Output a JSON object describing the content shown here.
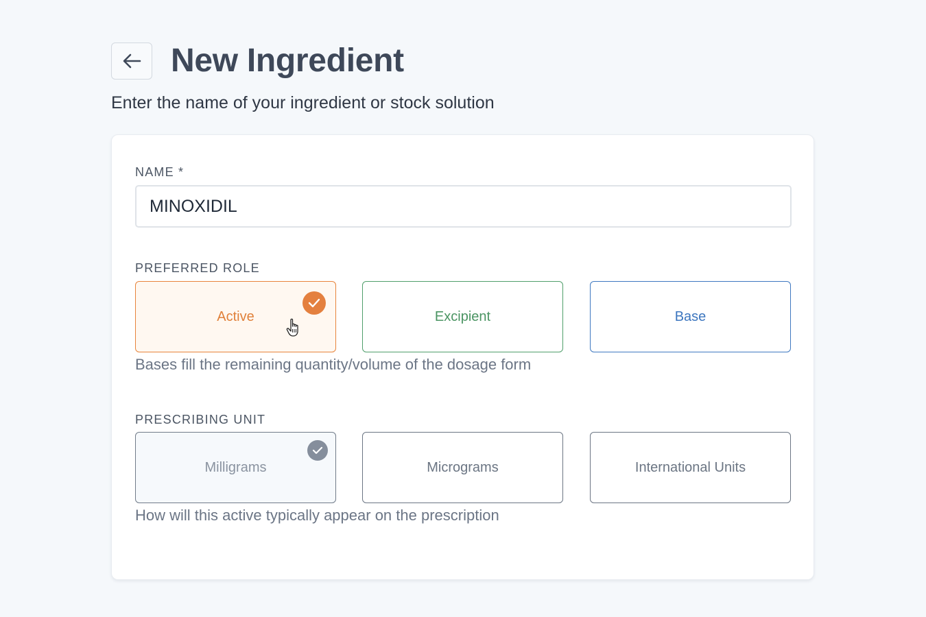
{
  "header": {
    "title": "New Ingredient",
    "subtitle": "Enter the name of your ingredient or stock solution",
    "back_icon": "arrow-left-icon"
  },
  "form": {
    "name": {
      "label": "NAME *",
      "value": "MINOXIDIL"
    },
    "preferred_role": {
      "label": "PREFERRED ROLE",
      "options": [
        {
          "label": "Active",
          "selected": true,
          "color": "#e0803a"
        },
        {
          "label": "Excipient",
          "selected": false,
          "color": "#4a9462"
        },
        {
          "label": "Base",
          "selected": false,
          "color": "#3c76bf"
        }
      ],
      "helper": "Bases fill the remaining quantity/volume of the dosage form"
    },
    "prescribing_unit": {
      "label": "PRESCRIBING UNIT",
      "options": [
        {
          "label": "Milligrams",
          "selected": true
        },
        {
          "label": "Micrograms",
          "selected": false
        },
        {
          "label": "International Units",
          "selected": false
        }
      ],
      "helper": "How will this active typically appear on the prescription"
    }
  },
  "icons": {
    "check": "check-icon",
    "cursor": "hand-pointer-icon"
  }
}
